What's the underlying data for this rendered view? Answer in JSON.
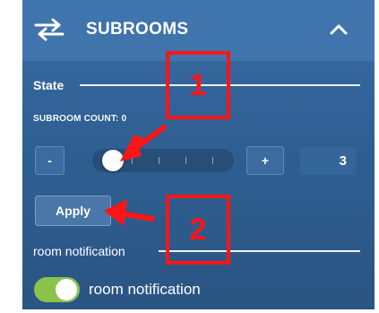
{
  "panel": {
    "title": "SUBROOMS",
    "header_icon": "swap-arrows-icon",
    "collapse_icon": "chevron-up-icon"
  },
  "state": {
    "section_label": "State",
    "subroom_count_label": "SUBROOM COUNT: 0",
    "decrement_label": "-",
    "increment_label": "+",
    "slider_value": 0,
    "slider_max": 4,
    "value_display": "3",
    "apply_label": "Apply"
  },
  "notification": {
    "section_label": "room notification",
    "toggle_label": "room notification",
    "toggle_on": true
  },
  "annotations": {
    "marker_1": "1",
    "marker_2": "2",
    "annotation_color": "#ff1515"
  },
  "colors": {
    "panel_bg": "#2f5f93",
    "toggle_on": "#8bc34a"
  }
}
